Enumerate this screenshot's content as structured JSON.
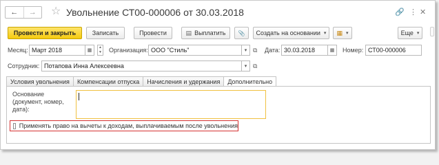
{
  "titlebar": {
    "back_icon": "arrow-left-icon",
    "forward_icon": "arrow-right-icon",
    "back_glyph": "←",
    "forward_glyph": "→",
    "favorite_glyph": "☆",
    "title": "Увольнение СТ00-000006 от 30.03.2018",
    "link_glyph": "🔗",
    "more_glyph": "⋮",
    "close_glyph": "✕"
  },
  "toolbar": {
    "post_close": "Провести и закрыть",
    "save": "Записать",
    "post": "Провести",
    "print": "Выплатить",
    "attach_glyph": "📎",
    "create_based": "Создать на основании",
    "report_glyph": "▦",
    "more": "Еще",
    "caret": "▾",
    "help": "?"
  },
  "fields": {
    "month_label": "Месяц:",
    "month_value": "Март 2018",
    "org_label": "Организация:",
    "org_value": "ООО \"Стиль\"",
    "date_label": "Дата:",
    "date_value": "30.03.2018",
    "number_label": "Номер:",
    "number_value": "СТ00-000006",
    "employee_label": "Сотрудник:",
    "employee_value": "Потапова Инна Алексеевна",
    "dropdown_glyph": "▾",
    "open_glyph": "⧉",
    "calendar_glyph": "▦",
    "spin_up": "▲",
    "spin_down": "▼"
  },
  "tabs": [
    {
      "label": "Условия увольнения"
    },
    {
      "label": "Компенсации отпуска"
    },
    {
      "label": "Начисления и удержания"
    },
    {
      "label": "Дополнительно"
    }
  ],
  "additional": {
    "basis_label": "Основание (документ, номер, дата):",
    "basis_value": "",
    "deductions_checkbox_label": "Применять право на вычеты к доходам, выплачиваемым после увольнения",
    "deductions_checked": false
  },
  "colors": {
    "primary_button": "#f5cb0f",
    "active_tab_underline": "#d22c2c",
    "highlight_border": "#d43030",
    "focus_border": "#f0c040"
  }
}
